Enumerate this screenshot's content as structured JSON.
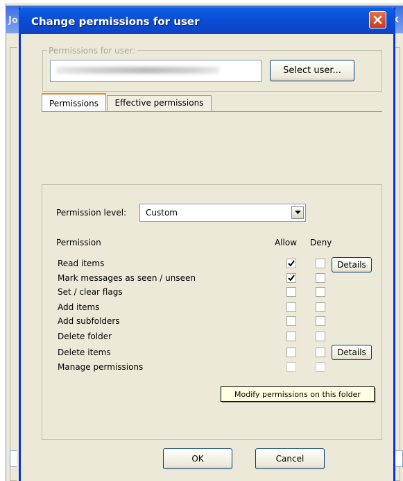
{
  "background_window": {
    "title_fragment": "Jo",
    "close_fragment": "x"
  },
  "dialog": {
    "title": "Change permissions for user"
  },
  "user_group": {
    "label": "Permissions for user:",
    "select_button": "Select user..."
  },
  "tabs": [
    {
      "label": "Permissions",
      "active": true
    },
    {
      "label": "Effective permissions",
      "active": false
    }
  ],
  "permission_level": {
    "label": "Permission level:",
    "value": "Custom"
  },
  "columns": {
    "permission": "Permission",
    "allow": "Allow",
    "deny": "Deny"
  },
  "permissions": [
    {
      "name": "Read items",
      "allow": true,
      "deny": false,
      "has_details": true
    },
    {
      "name": "Mark messages as seen / unseen",
      "allow": true,
      "deny": false,
      "has_details": false
    },
    {
      "name": "Set / clear flags",
      "allow": false,
      "deny": false,
      "has_details": false
    },
    {
      "name": "Add items",
      "allow": false,
      "deny": false,
      "has_details": false
    },
    {
      "name": "Add subfolders",
      "allow": false,
      "deny": false,
      "has_details": false
    },
    {
      "name": "Delete folder",
      "allow": false,
      "deny": false,
      "has_details": false
    },
    {
      "name": "Delete items",
      "allow": false,
      "deny": false,
      "has_details": true
    },
    {
      "name": "Manage permissions",
      "allow": false,
      "deny": false,
      "has_details": false
    }
  ],
  "details_label": "Details",
  "tooltip": "Modify permissions on this folder",
  "buttons": {
    "ok": "OK",
    "cancel": "Cancel"
  },
  "colors": {
    "titlebar": "#0a4fd6",
    "dialog_bg": "#ece9d8",
    "close_button": "#c9381b",
    "tooltip_bg": "#ffffe1"
  }
}
